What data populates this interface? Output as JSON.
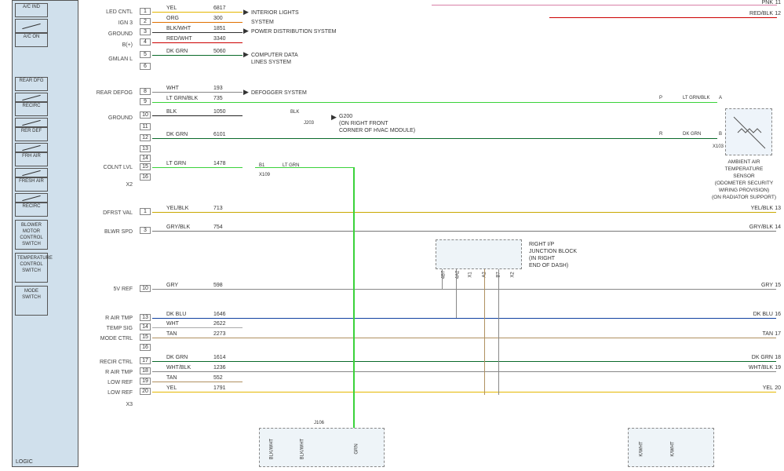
{
  "logic_label": "LOGIC",
  "switches": {
    "ac_ind": "A/C\nIND",
    "ac_on": "A/C\nON",
    "rear_dfg": "REAR\nDFG",
    "recirc": "RECIRC",
    "rer_def": "RER DEF",
    "frh_air": "FRH AIR",
    "fresh_air": "FRESH\nAIR",
    "recirc2": "RECIRC"
  },
  "control_boxes": {
    "blower": "BLOWER\nMOTOR\nCONTROL\nSWITCH",
    "temp": "TEMPERATURE\nCONTROL\nSWITCH",
    "mode": "MODE\nSWITCH"
  },
  "pins": {
    "led_cntl": "LED CNTL",
    "ign3": "IGN 3",
    "ground": "GROUND",
    "bplus": "B(+)",
    "gmlan": "GMLAN L",
    "rear_defog": "REAR DEFOG",
    "ground2": "GROUND",
    "colnt_lvl": "COLNT LVL",
    "x2": "X2",
    "dfrst_val": "DFRST VAL",
    "blwr_spd": "BLWR SPD",
    "5v_ref": "5V REF",
    "r_air_tmp": "R AIR TMP",
    "temp_sig": "TEMP SIG",
    "mode_ctrl": "MODE CTRL",
    "recir_ctrl": "RECIR CTRL",
    "r_air_tmp2": "R AIR TMP",
    "low_ref": "LOW REF",
    "low_ref2": "LOW REF",
    "x3": "X3"
  },
  "wires": [
    {
      "n": "1",
      "color": "YEL",
      "code": "6817",
      "hex": "#e5b700",
      "sys": "INTERIOR LIGHTS"
    },
    {
      "n": "2",
      "color": "ORG",
      "code": "300",
      "hex": "#e07000",
      "sys": "SYSTEM"
    },
    {
      "n": "3",
      "color": "BLK/WHT",
      "code": "1851",
      "hex": "#333",
      "sys": "POWER DISTRIBUTION SYSTEM"
    },
    {
      "n": "4",
      "color": "RED/WHT",
      "code": "3340",
      "hex": "#c00"
    },
    {
      "n": "5",
      "color": "DK GRN",
      "code": "5060",
      "hex": "#0a6a2a",
      "sys": "COMPUTER DATA\nLINES SYSTEM"
    },
    {
      "n": "6",
      "color": "",
      "code": "",
      "hex": ""
    },
    {
      "n": "8",
      "color": "WHT",
      "code": "193",
      "hex": "#888",
      "sys": "DEFOGGER SYSTEM"
    },
    {
      "n": "9",
      "color": "LT GRN/BLK",
      "code": "735",
      "hex": "#3ad23a"
    },
    {
      "n": "10",
      "color": "BLK",
      "code": "1050",
      "hex": "#222"
    },
    {
      "n": "11",
      "color": "",
      "code": "",
      "hex": ""
    },
    {
      "n": "12",
      "color": "DK GRN",
      "code": "6101",
      "hex": "#0a6a2a"
    },
    {
      "n": "13",
      "color": "",
      "code": "",
      "hex": ""
    },
    {
      "n": "14",
      "color": "",
      "code": "",
      "hex": ""
    },
    {
      "n": "15",
      "color": "LT GRN",
      "code": "1478",
      "hex": "#3ad23a"
    },
    {
      "n": "16",
      "color": "",
      "code": "",
      "hex": ""
    },
    {
      "n": "1b",
      "nn": "1",
      "color": "YEL/BLK",
      "code": "713",
      "hex": "#c9a800"
    },
    {
      "n": "3b",
      "nn": "3",
      "color": "GRY/BLK",
      "code": "754",
      "hex": "#777"
    },
    {
      "n": "10b",
      "nn": "10",
      "color": "GRY",
      "code": "598",
      "hex": "#888"
    },
    {
      "n": "13b",
      "nn": "13",
      "color": "DK BLU",
      "code": "1646",
      "hex": "#1040a0"
    },
    {
      "n": "14b",
      "nn": "14",
      "color": "WHT",
      "code": "2622",
      "hex": "#aaa"
    },
    {
      "n": "15b",
      "nn": "15",
      "color": "TAN",
      "code": "2273",
      "hex": "#b09060"
    },
    {
      "n": "16b",
      "nn": "16",
      "color": "",
      "code": "",
      "hex": ""
    },
    {
      "n": "17",
      "color": "DK GRN",
      "code": "1614",
      "hex": "#0a6a2a"
    },
    {
      "n": "18",
      "color": "WHT/BLK",
      "code": "1236",
      "hex": "#888"
    },
    {
      "n": "19",
      "color": "TAN",
      "code": "552",
      "hex": "#b09060"
    },
    {
      "n": "20",
      "color": "YEL",
      "code": "1791",
      "hex": "#e5b700"
    }
  ],
  "right_side": {
    "pnk": "PNK",
    "pnk_n": "11",
    "redblk": "RED/BLK",
    "redblk_n": "12",
    "ltgrnblk": "LT GRN/BLK",
    "ltgrnblk_p": "P",
    "ltgrnblk_a": "A",
    "dkgrn": "DK GRN",
    "dkgrn_r": "R",
    "dkgrn_b": "B",
    "x103": "X103",
    "yelblk": "YEL/BLK",
    "yelblk_n": "13",
    "gryblk": "GRY/BLK",
    "gryblk_n": "14",
    "gry": "GRY",
    "gry_n": "15",
    "dkblu": "DK BLU",
    "dkblu_n": "16",
    "tan": "TAN",
    "tan_n": "17",
    "dkgrn2": "DK GRN",
    "dkgrn2_n": "18",
    "whtblk": "WHT/BLK",
    "whtblk_n": "19",
    "yel": "YEL",
    "yel_n": "20"
  },
  "junction": {
    "title": "RIGHT I/P\nJUNCTION BLOCK\n(IN RIGHT\nEND OF DASH)",
    "pins": [
      "4B7",
      "4A2",
      "X1",
      "A2",
      "B7",
      "X2"
    ]
  },
  "g200": "G200\n(ON RIGHT FRONT\nCORNER OF HVAC MODULE)",
  "j203": "J203",
  "blk_lbl": "BLK",
  "b1": "B1",
  "x109": "X109",
  "ltgrn2": "LT GRN",
  "sensor": "AMBIENT AIR\nTEMPERATURE\nSENSOR\n(ODOMETER SECURITY\nWIRING PROVISION)\n(ON RADIATOR SUPPORT)",
  "j106": "J106",
  "bottom_v": [
    "BLK/WHT",
    "BLK/WHT",
    "GRN",
    "K/WHT",
    "K/WHT"
  ]
}
